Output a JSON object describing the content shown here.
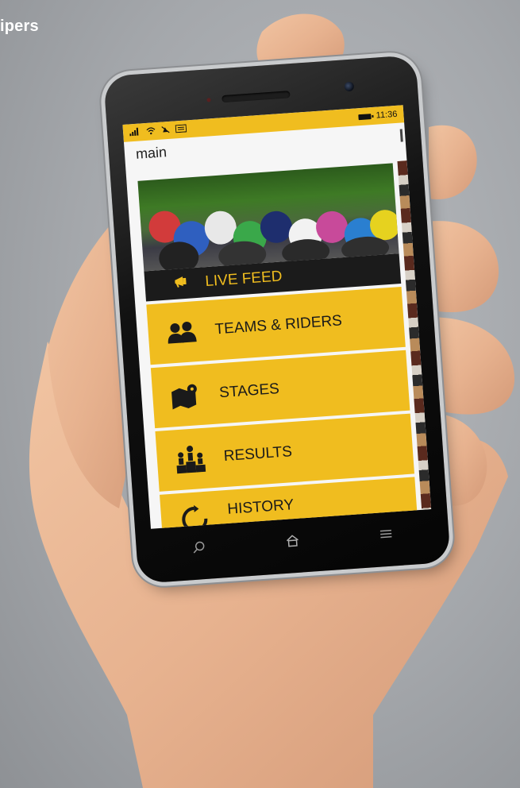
{
  "corner_caption": "ipers",
  "status_bar": {
    "time": "11:36",
    "icons": [
      "signal-icon",
      "wifi-icon",
      "mute-icon",
      "message-icon"
    ],
    "battery_icon": "battery-icon"
  },
  "app": {
    "title": "main",
    "hero_image": "peloton-photo",
    "live_feed_label": "LIVE FEED",
    "menu": [
      {
        "label": "TEAMS & RIDERS",
        "icon": "people-icon"
      },
      {
        "label": "STAGES",
        "icon": "map-icon"
      },
      {
        "label": "RESULTS",
        "icon": "podium-icon"
      },
      {
        "label": "HISTORY",
        "icon": "history-icon"
      }
    ]
  },
  "navbar": {
    "items": [
      "search-icon",
      "home-icon",
      "menu-icon"
    ]
  },
  "colors": {
    "accent": "#f0bd1f",
    "dark": "#1b1b1b",
    "screen_bg": "#f6f6f6"
  }
}
